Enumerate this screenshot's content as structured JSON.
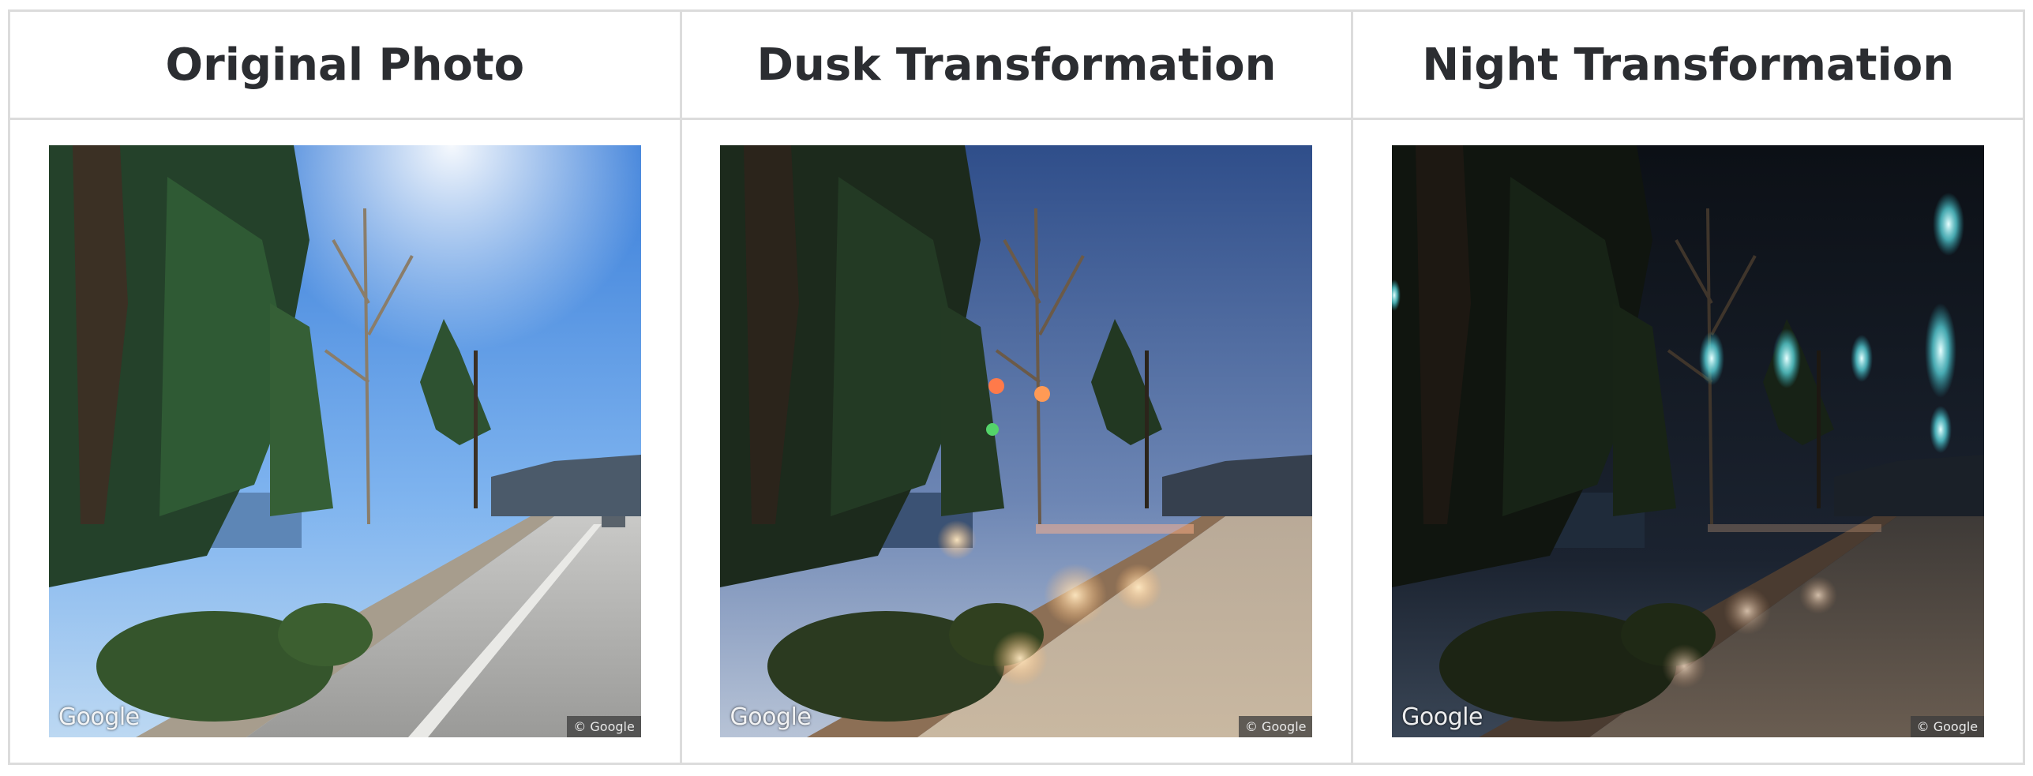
{
  "columns": [
    {
      "title": "Original Photo",
      "watermark_logo": "Google",
      "watermark_copyright": "© Google"
    },
    {
      "title": "Dusk Transformation",
      "watermark_logo": "Google",
      "watermark_copyright": "© Google"
    },
    {
      "title": "Night Transformation",
      "watermark_logo": "Google",
      "watermark_copyright": "© Google"
    }
  ],
  "colors": {
    "border": "#dcdcdc",
    "header_text": "#2b2d31"
  }
}
